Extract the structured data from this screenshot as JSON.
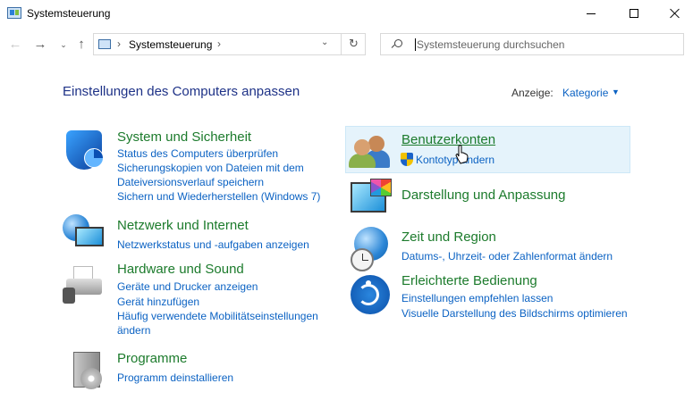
{
  "window": {
    "title": "Systemsteuerung",
    "minimize_glyph": "—",
    "maximize_glyph": "☐",
    "close_glyph": "✕"
  },
  "nav": {
    "back_glyph": "←",
    "forward_glyph": "→",
    "recent_glyph": "⌄",
    "up_glyph": "↑",
    "breadcrumb": "Systemsteuerung",
    "refresh_glyph": "↻",
    "search_placeholder": "Systemsteuerung durchsuchen"
  },
  "main": {
    "title": "Einstellungen des Computers anpassen",
    "view_label": "Anzeige:",
    "view_value": "Kategorie",
    "view_caret": "▼"
  },
  "categories": [
    {
      "title": "System und Sicherheit",
      "icon": "shield-icon",
      "links": [
        "Status des Computers überprüfen",
        "Sicherungskopien von Dateien mit dem",
        "Dateiversionsverlauf speichern",
        "Sichern und Wiederherstellen (Windows 7)"
      ]
    },
    {
      "title": "Netzwerk und Internet",
      "icon": "network-globe-icon",
      "links": [
        "Netzwerkstatus und -aufgaben anzeigen"
      ]
    },
    {
      "title": "Hardware und Sound",
      "icon": "printer-speaker-icon",
      "links": [
        "Geräte und Drucker anzeigen",
        "Gerät hinzufügen",
        "Häufig verwendete Mobilitätseinstellungen",
        "ändern"
      ]
    },
    {
      "title": "Programme",
      "icon": "programs-box-icon",
      "links": [
        "Programm deinstallieren"
      ]
    },
    {
      "title": "Benutzerkonten",
      "icon": "users-icon",
      "links": [
        "Kontotyp ändern"
      ]
    },
    {
      "title": "Darstellung und Anpassung",
      "icon": "display-palette-icon",
      "links": []
    },
    {
      "title": "Zeit und Region",
      "icon": "globe-clock-icon",
      "links": [
        "Datums-, Uhrzeit- oder Zahlenformat ändern"
      ]
    },
    {
      "title": "Erleichterte Bedienung",
      "icon": "accessibility-icon",
      "links": [
        "Einstellungen empfehlen lassen",
        "Visuelle Darstellung des Bildschirms optimieren"
      ]
    }
  ],
  "colors": {
    "title": "#1e3287",
    "category": "#1c7b2c",
    "link": "#0b62c3",
    "hover": "#e5f3fb"
  }
}
